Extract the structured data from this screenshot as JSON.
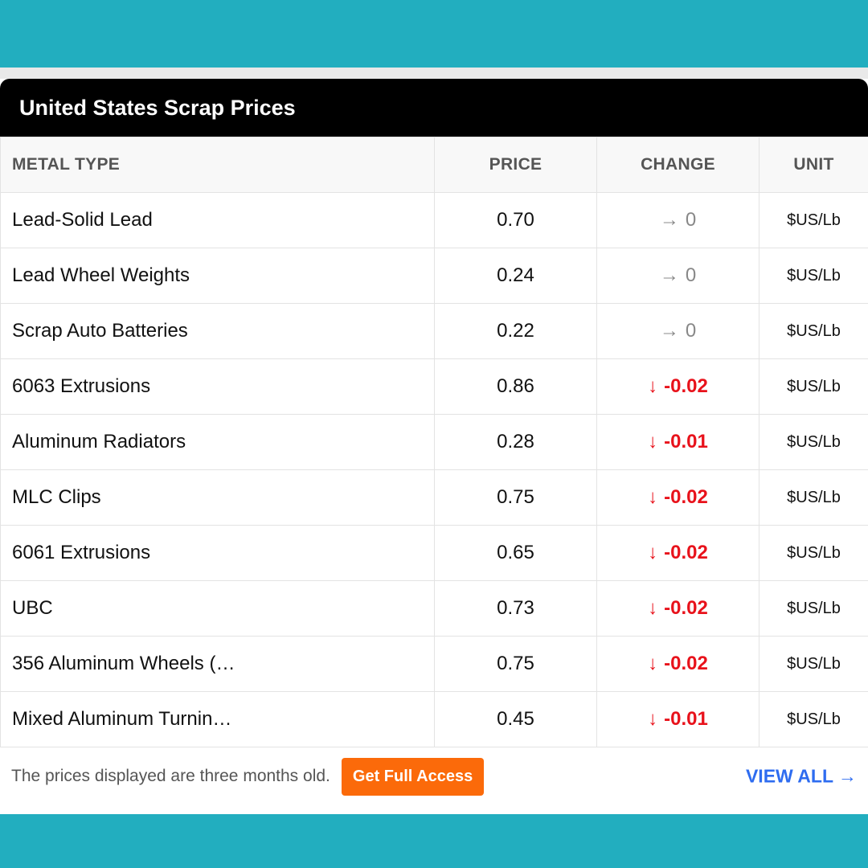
{
  "widget": {
    "title": "United States Scrap Prices",
    "columns": {
      "metal": "METAL TYPE",
      "price": "PRICE",
      "change": "CHANGE",
      "unit": "UNIT"
    },
    "rows": [
      {
        "metal": "Lead-Solid Lead",
        "price": "0.70",
        "change_arrow": "→",
        "change": "0",
        "direction": "flat",
        "unit": "$US/Lb"
      },
      {
        "metal": "Lead Wheel Weights",
        "price": "0.24",
        "change_arrow": "→",
        "change": "0",
        "direction": "flat",
        "unit": "$US/Lb"
      },
      {
        "metal": "Scrap Auto Batteries",
        "price": "0.22",
        "change_arrow": "→",
        "change": "0",
        "direction": "flat",
        "unit": "$US/Lb"
      },
      {
        "metal": "6063 Extrusions",
        "price": "0.86",
        "change_arrow": "↓",
        "change": "-0.02",
        "direction": "down",
        "unit": "$US/Lb"
      },
      {
        "metal": "Aluminum Radiators",
        "price": "0.28",
        "change_arrow": "↓",
        "change": "-0.01",
        "direction": "down",
        "unit": "$US/Lb"
      },
      {
        "metal": "MLC Clips",
        "price": "0.75",
        "change_arrow": "↓",
        "change": "-0.02",
        "direction": "down",
        "unit": "$US/Lb"
      },
      {
        "metal": "6061 Extrusions",
        "price": "0.65",
        "change_arrow": "↓",
        "change": "-0.02",
        "direction": "down",
        "unit": "$US/Lb"
      },
      {
        "metal": "UBC",
        "price": "0.73",
        "change_arrow": "↓",
        "change": "-0.02",
        "direction": "down",
        "unit": "$US/Lb"
      },
      {
        "metal": "356 Aluminum Wheels (…",
        "price": "0.75",
        "change_arrow": "↓",
        "change": "-0.02",
        "direction": "down",
        "unit": "$US/Lb"
      },
      {
        "metal": "Mixed Aluminum Turnin…",
        "price": "0.45",
        "change_arrow": "↓",
        "change": "-0.01",
        "direction": "down",
        "unit": "$US/Lb"
      }
    ],
    "footer": {
      "note": "The prices displayed are three months old.",
      "cta_label": "Get Full Access",
      "view_all_label": "VIEW ALL",
      "view_all_arrow": "→"
    }
  },
  "colors": {
    "background": "#22aebf",
    "down": "#e8121b",
    "flat": "#888888",
    "cta": "#fb6a0a",
    "link": "#2e6cf0"
  }
}
